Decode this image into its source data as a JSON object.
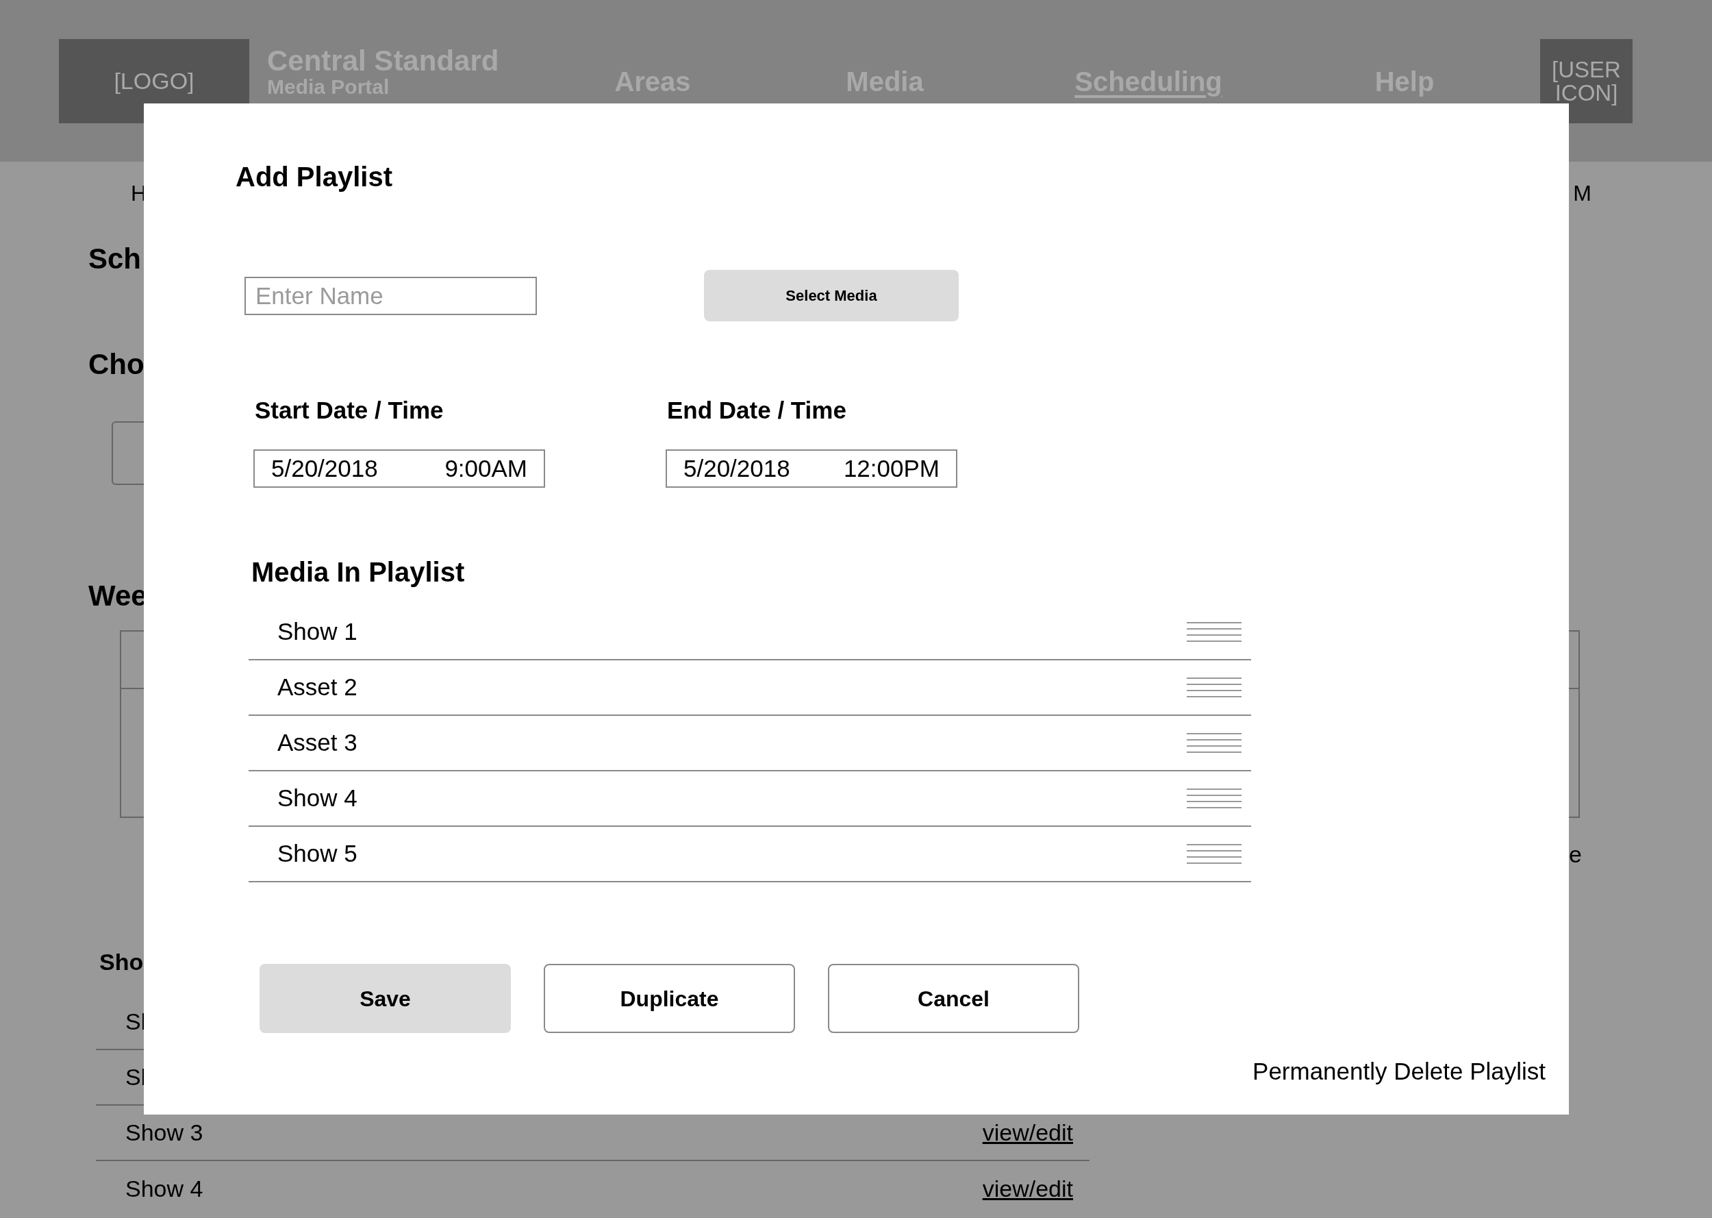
{
  "header": {
    "logo": "[LOGO]",
    "title": "Central Standard",
    "subtitle": "Media Portal",
    "nav": [
      {
        "label": "Areas",
        "selected": false
      },
      {
        "label": "Media",
        "selected": false
      },
      {
        "label": "Scheduling",
        "selected": true
      },
      {
        "label": "Help",
        "selected": false
      }
    ],
    "user": "[USER ICON]"
  },
  "background": {
    "top_left": "H",
    "top_right": "M",
    "section_1": "Sch",
    "section_2": "Cho",
    "section_3": "Wee",
    "table_side_text": "e",
    "section_4": "Sho",
    "shows": [
      {
        "name": "Sl"
      },
      {
        "name": "Sl"
      },
      {
        "name": "Show 3",
        "link": "view/edit"
      },
      {
        "name": "Show 4",
        "link": "view/edit"
      }
    ]
  },
  "dialog": {
    "title": "Add Playlist",
    "name_field": {
      "placeholder": "Enter Name"
    },
    "select_media": "Select Media",
    "start": {
      "label": "Start Date / Time",
      "date": "5/20/2018",
      "time": "9:00AM"
    },
    "end": {
      "label": "End Date / Time",
      "date": "5/20/2018",
      "time": "12:00PM"
    },
    "media_heading": "Media In Playlist",
    "media": [
      "Show 1",
      "Asset 2",
      "Asset 3",
      "Show 4",
      "Show 5"
    ],
    "buttons": [
      {
        "label": "Save",
        "kind": "primary"
      },
      {
        "label": "Duplicate",
        "kind": "secondary"
      },
      {
        "label": "Cancel",
        "kind": "secondary"
      }
    ],
    "delete_link": "Permanently Delete Playlist"
  }
}
